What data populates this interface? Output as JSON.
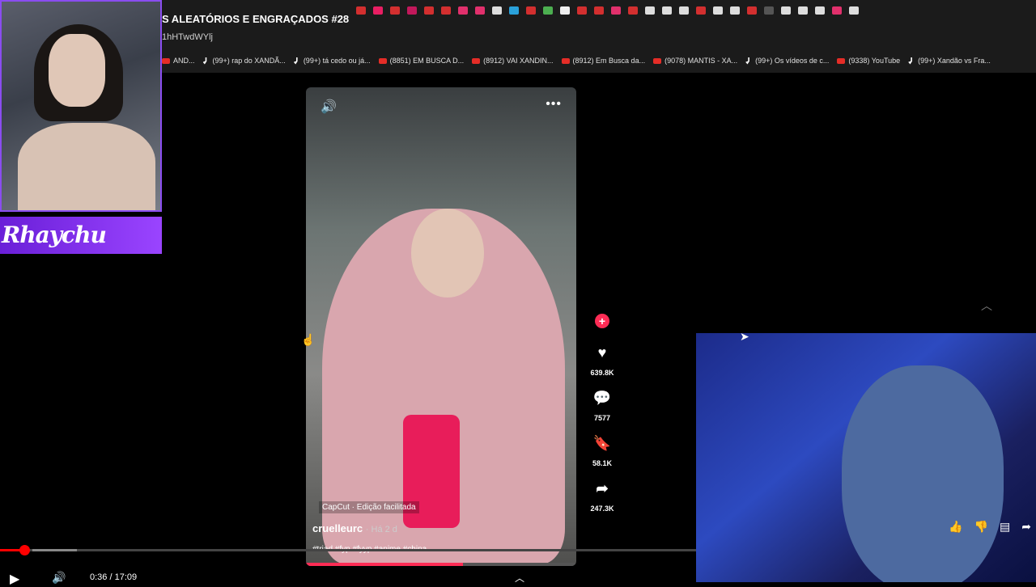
{
  "browser": {
    "title": "S ALEATÓRIOS E ENGRAÇADOS #28",
    "url": "1hHTwdWYlj",
    "bookmarks": [
      {
        "icon": "youtube",
        "label": "AND..."
      },
      {
        "icon": "tiktok",
        "label": "(99+) rap do XANDÃ..."
      },
      {
        "icon": "tiktok",
        "label": "(99+) tá cedo ou já..."
      },
      {
        "icon": "youtube",
        "label": "(8851) EM BUSCA D..."
      },
      {
        "icon": "youtube",
        "label": "(8912) VAI XANDIN..."
      },
      {
        "icon": "youtube",
        "label": "(8912) Em Busca da..."
      },
      {
        "icon": "youtube",
        "label": "(9078) MANTIS - XA..."
      },
      {
        "icon": "tiktok",
        "label": "(99+) Os vídeos de c..."
      },
      {
        "icon": "youtube",
        "label": "(9338) YouTube"
      },
      {
        "icon": "tiktok",
        "label": "(99+) Xandão vs Fra..."
      }
    ]
  },
  "streamer_overlay": {
    "name": "Rhaychu"
  },
  "tiktok": {
    "capcut_label": "CapCut · Edição facilitada",
    "author": "cruelleurc",
    "posted": "· Há 2 d",
    "tags": "#triad #fyp #fyyp #anime #china",
    "likes": "639.8K",
    "comments": "7577",
    "saves": "58.1K",
    "shares": "247.3K",
    "progress": 0.58
  },
  "player": {
    "time": "0:36 / 17:09",
    "progress": 0.035
  },
  "colors": {
    "accent": "#fe2c55",
    "yt_red": "#ff0000",
    "overlay_purple": "#8a4df0"
  }
}
